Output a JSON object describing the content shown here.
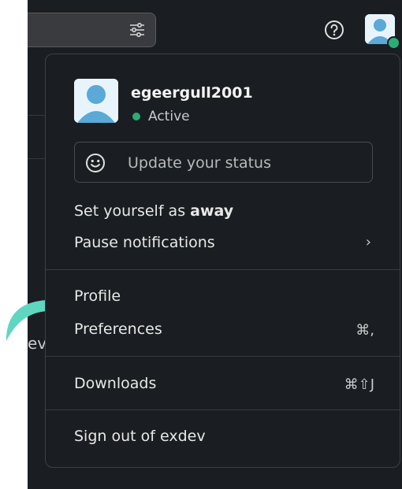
{
  "user": {
    "name": "egeergull2001",
    "status": "Active"
  },
  "status_input": {
    "placeholder": "Update your status"
  },
  "menu": {
    "away_prefix": "Set yourself as ",
    "away_bold": "away",
    "pause_notifications": "Pause notifications",
    "pause_chevron": "›",
    "profile": "Profile",
    "preferences": "Preferences",
    "preferences_shortcut": "⌘,",
    "downloads": "Downloads",
    "downloads_shortcut": "⌘⇧J",
    "sign_out": "Sign out of exdev"
  },
  "background": {
    "partial_text": "eve"
  },
  "colors": {
    "active_green": "#2bac76",
    "arrow_teal": "#5fd6c0",
    "avatar_blue": "#5aa9d6"
  },
  "icons": [
    "filter-icon",
    "help-icon",
    "smile-icon",
    "curved-arrow-icon"
  ]
}
